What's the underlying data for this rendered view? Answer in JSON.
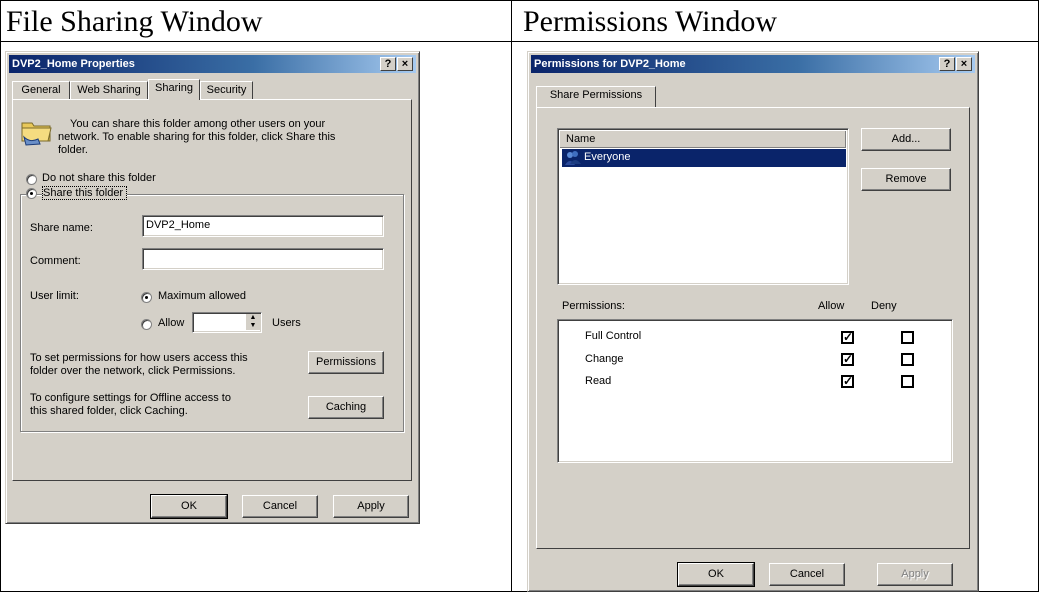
{
  "columns": {
    "left_title": "File Sharing Window",
    "right_title": "Permissions Window"
  },
  "properties": {
    "title": "DVP2_Home Properties",
    "help_btn": "?",
    "close_btn": "×",
    "tabs": [
      "General",
      "Web Sharing",
      "Sharing",
      "Security"
    ],
    "active_tab": "Sharing",
    "intro_text_1": "You can share this folder among other users on your",
    "intro_text_2": "network.  To enable sharing for this folder, click Share this",
    "intro_text_3": "folder.",
    "radio_no_share": "Do not share this folder",
    "radio_share": "Share this folder",
    "share_name_label": "Share name:",
    "share_name_value": "DVP2_Home",
    "comment_label": "Comment:",
    "comment_value": "",
    "user_limit_label": "User limit:",
    "max_allowed": "Maximum allowed",
    "allow_label": "Allow",
    "users_label": "Users",
    "perm_text_1": "To set permissions for how users access this",
    "perm_text_2": "folder over the network, click Permissions.",
    "permissions_btn": "Permissions",
    "cache_text_1": "To configure settings for Offline access to",
    "cache_text_2": "this shared folder, click Caching.",
    "caching_btn": "Caching",
    "ok": "OK",
    "cancel": "Cancel",
    "apply": "Apply"
  },
  "permissions": {
    "title": "Permissions for DVP2_Home",
    "help_btn": "?",
    "close_btn": "×",
    "tab": "Share Permissions",
    "name_header": "Name",
    "names": [
      "Everyone"
    ],
    "add_btn": "Add...",
    "remove_btn": "Remove",
    "permissions_label": "Permissions:",
    "allow_header": "Allow",
    "deny_header": "Deny",
    "rows": [
      {
        "name": "Full Control",
        "allow": true,
        "deny": false
      },
      {
        "name": "Change",
        "allow": true,
        "deny": false
      },
      {
        "name": "Read",
        "allow": true,
        "deny": false
      }
    ],
    "ok": "OK",
    "cancel": "Cancel",
    "apply": "Apply"
  }
}
